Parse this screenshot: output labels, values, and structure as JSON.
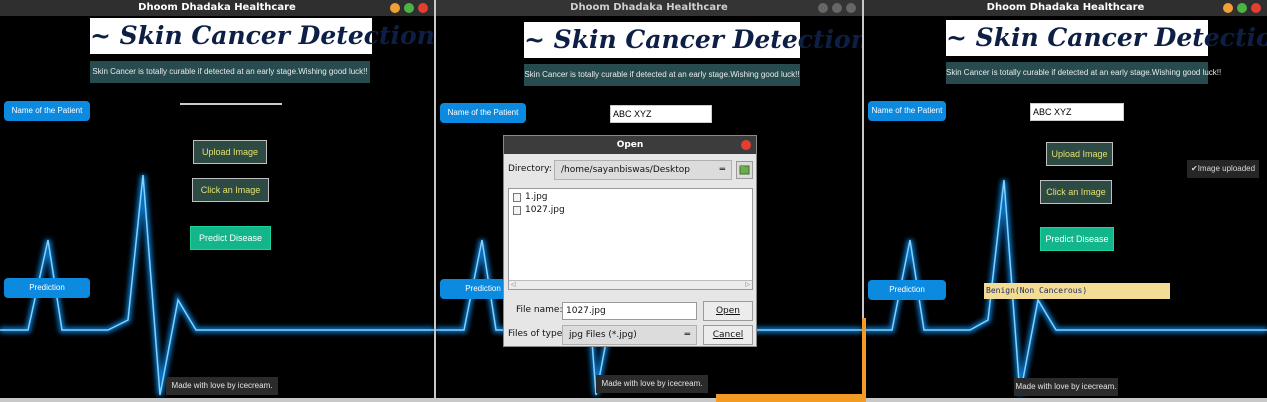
{
  "windows": [
    {
      "title": "Dhoom Dhadaka Healthcare",
      "heading": "~ Skin Cancer Detection ~",
      "tagline": "Skin Cancer is totally curable if detected at an early stage.Wishing good luck!!",
      "name_label": "Name of the Patient",
      "name_value": "",
      "upload_label": "Upload Image",
      "click_label": "Click an Image",
      "predict_label": "Predict Disease",
      "prediction_label": "Prediction",
      "prediction_value": "",
      "footer": "Made with love by icecream."
    },
    {
      "title": "Dhoom Dhadaka Healthcare",
      "heading": "~ Skin Cancer Detection ~",
      "tagline": "Skin Cancer is totally curable if detected at an early stage.Wishing good luck!!",
      "name_label": "Name of the Patient",
      "name_value": "ABC XYZ",
      "prediction_label": "Prediction",
      "footer": "Made with love by icecream."
    },
    {
      "title": "Dhoom Dhadaka Healthcare",
      "heading": "~ Skin Cancer Detection ~",
      "tagline": "Skin Cancer is totally curable if detected at an early stage.Wishing good luck!!",
      "name_label": "Name of the Patient",
      "name_value": "ABC XYZ",
      "upload_label": "Upload Image",
      "upload_status": "✔Image uploaded",
      "click_label": "Click an Image",
      "predict_label": "Predict Disease",
      "prediction_label": "Prediction",
      "prediction_value": "Benign(Non Cancerous)",
      "footer": "Made with love by icecream."
    }
  ],
  "dialog": {
    "title": "Open",
    "directory_label": "Directory:",
    "directory_value": "/home/sayanbiswas/Desktop",
    "files": [
      "1.jpg",
      "1027.jpg"
    ],
    "filename_label": "File name:",
    "filename_value": "1027.jpg",
    "filetype_label": "Files of type:",
    "filetype_value": "jpg Files (*.jpg)",
    "open_label": "Open",
    "cancel_label": "Cancel",
    "folder_icon": "new-folder-icon"
  },
  "colors": {
    "heading_bg": "#ffffff",
    "tagline_bg": "#274b4e",
    "pill_blue": "#0c8ae0",
    "predict_green": "#12b68a",
    "prediction_box": "#f3dc93",
    "ecg_glow": "#19a9ff",
    "dot_close": "#e53e30",
    "dot_min": "#f0a034",
    "dot_max": "#4bb543"
  }
}
